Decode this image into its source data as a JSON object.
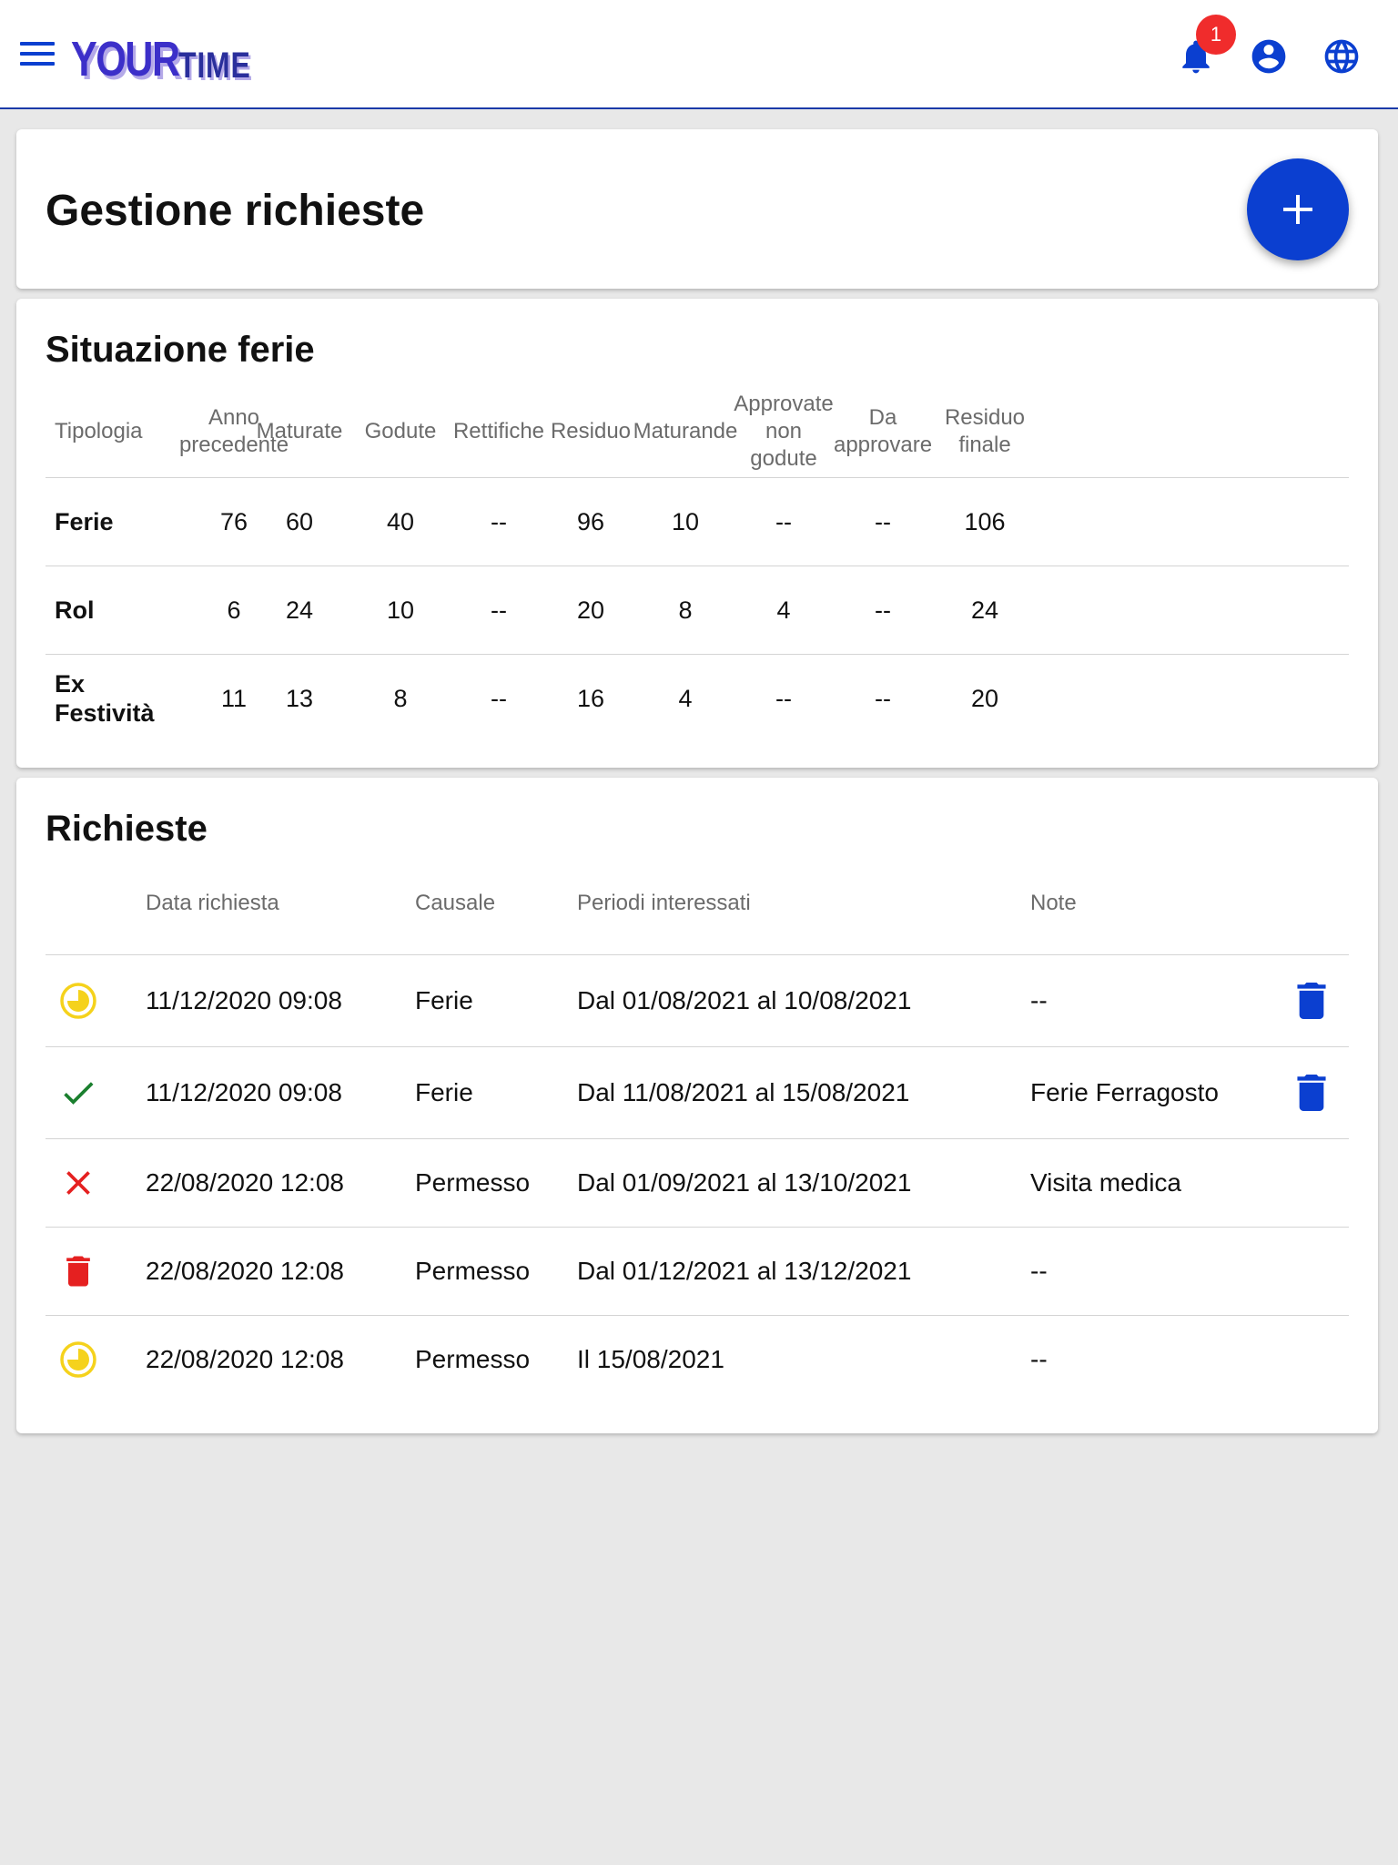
{
  "header": {
    "logo_your": "YOUR",
    "logo_time": "TIME",
    "notifications_count": "1"
  },
  "page": {
    "title": "Gestione richieste"
  },
  "ferie": {
    "title": "Situazione ferie",
    "columns": [
      "Tipologia",
      "Anno precedente",
      "Maturate",
      "Godute",
      "Rettifiche",
      "Residuo",
      "Maturande",
      "Approvate non godute",
      "Da approvare",
      "Residuo finale"
    ],
    "rows": [
      {
        "tipologia": "Ferie",
        "cells": [
          "76",
          "60",
          "40",
          "--",
          "96",
          "10",
          "--",
          "--",
          "106"
        ]
      },
      {
        "tipologia": "Rol",
        "cells": [
          "6",
          "24",
          "10",
          "--",
          "20",
          "8",
          "4",
          "--",
          "24"
        ]
      },
      {
        "tipologia": "Ex Festività",
        "cells": [
          "11",
          "13",
          "8",
          "--",
          "16",
          "4",
          "--",
          "--",
          "20"
        ]
      }
    ]
  },
  "richieste": {
    "title": "Richieste",
    "columns": [
      "Data richiesta",
      "Causale",
      "Periodi interessati",
      "Note"
    ],
    "rows": [
      {
        "status": "pending",
        "status_icon": "pending-icon",
        "data": "11/12/2020 09:08",
        "causale": "Ferie",
        "periodo": "Dal 01/08/2021 al 10/08/2021",
        "note": "--",
        "deletable": true
      },
      {
        "status": "approved",
        "status_icon": "check-icon",
        "data": "11/12/2020 09:08",
        "causale": "Ferie",
        "periodo": "Dal 11/08/2021 al 15/08/2021",
        "note": "Ferie Ferragosto",
        "deletable": true
      },
      {
        "status": "rejected",
        "status_icon": "close-icon",
        "data": "22/08/2020 12:08",
        "causale": "Permesso",
        "periodo": "Dal 01/09/2021 al 13/10/2021",
        "note": "Visita medica",
        "deletable": false
      },
      {
        "status": "deleted",
        "status_icon": "trash-icon",
        "data": "22/08/2020 12:08",
        "causale": "Permesso",
        "periodo": "Dal 01/12/2021 al 13/12/2021",
        "note": "--",
        "deletable": false
      },
      {
        "status": "pending",
        "status_icon": "pending-icon",
        "data": "22/08/2020 12:08",
        "causale": "Permesso",
        "periodo": "Il 15/08/2021",
        "note": "--",
        "deletable": false
      }
    ]
  },
  "colors": {
    "primary": "#0b3fd0",
    "pending": "#f5d21c",
    "approved": "#1a7f2e",
    "rejected": "#e52020",
    "badge": "#f02c2c"
  }
}
